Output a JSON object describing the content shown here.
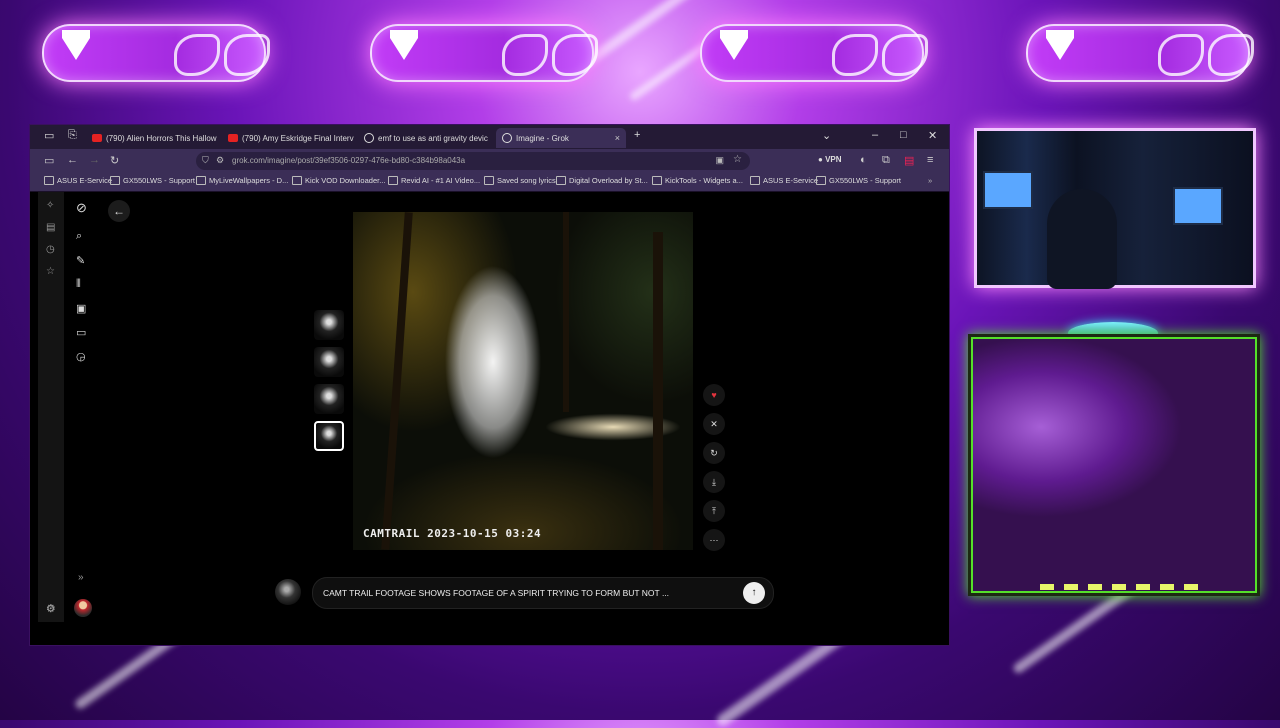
{
  "tabs": [
    {
      "label": "(790) Alien Horrors This Hallow"
    },
    {
      "label": "(790) Amy Eskridge Final Interv"
    },
    {
      "label": "emf to use as anti gravity devic"
    },
    {
      "label": "Imagine - Grok"
    }
  ],
  "address": {
    "url": "grok.com/imagine/post/39ef3506-0297-476e-bd80-c384b98a043a"
  },
  "vpn_label": "VPN",
  "bookmarks": [
    {
      "label": "ASUS E-Service"
    },
    {
      "label": "GX550LWS - Support"
    },
    {
      "label": "MyLiveWallpapers - D..."
    },
    {
      "label": "Kick VOD Downloader..."
    },
    {
      "label": "Revid AI - #1 AI Video..."
    },
    {
      "label": "Saved song lyrics"
    },
    {
      "label": "Digital Overload by St..."
    },
    {
      "label": "KickTools - Widgets a..."
    },
    {
      "label": "ASUS E-Service"
    },
    {
      "label": "GX550LWS - Support"
    }
  ],
  "image": {
    "caption": "CAMTRAIL 2023-10-15 03:24"
  },
  "prompt": {
    "text": "CAMT TRAIL FOOTAGE SHOWS FOOTAGE OF A SPIRIT TRYING TO FORM BUT NOT ..."
  },
  "icons": {
    "back": "arrow-left",
    "actions": [
      "heart-icon",
      "x-share-icon",
      "refresh-icon",
      "download-icon",
      "share-icon",
      "more-icon"
    ]
  }
}
